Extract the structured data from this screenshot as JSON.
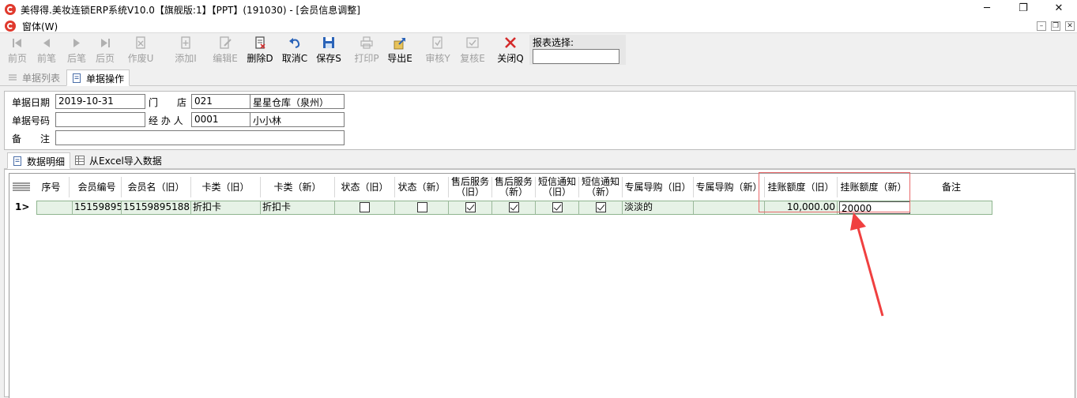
{
  "window": {
    "title": "美得得.美妆连锁ERP系统V10.0【旗舰版:1】【PPT】(191030) - [会员信息调整]",
    "menu": "窗体(W)"
  },
  "toolbar": {
    "buttons": [
      {
        "label": "前页",
        "icon": "first-page-icon",
        "enabled": false
      },
      {
        "label": "前笔",
        "icon": "prev-record-icon",
        "enabled": false
      },
      {
        "label": "后笔",
        "icon": "next-record-icon",
        "enabled": false
      },
      {
        "label": "后页",
        "icon": "last-page-icon",
        "enabled": false
      },
      {
        "label": "作废U",
        "icon": "void-doc-icon",
        "enabled": false
      },
      {
        "label": "添加I",
        "icon": "add-doc-icon",
        "enabled": false
      },
      {
        "label": "编辑E",
        "icon": "edit-doc-icon",
        "enabled": false
      },
      {
        "label": "删除D",
        "icon": "delete-doc-icon",
        "enabled": true
      },
      {
        "label": "取消C",
        "icon": "undo-icon",
        "enabled": true
      },
      {
        "label": "保存S",
        "icon": "save-icon",
        "enabled": true
      },
      {
        "label": "打印P",
        "icon": "printer-icon",
        "enabled": false
      },
      {
        "label": "导出E",
        "icon": "export-icon",
        "enabled": true
      },
      {
        "label": "审核Y",
        "icon": "approve-icon",
        "enabled": false
      },
      {
        "label": "复核E",
        "icon": "recheck-icon",
        "enabled": false
      },
      {
        "label": "关闭Q",
        "icon": "close-icon",
        "enabled": true
      }
    ],
    "report_select_label": "报表选择:",
    "report_select_value": ""
  },
  "tabs": {
    "list": "单据列表",
    "operate": "单据操作"
  },
  "form": {
    "date_label": "单据日期",
    "date_value": "2019-10-31",
    "store_label": "门　　店",
    "store_code": "021",
    "store_name": "星星仓库（泉州）",
    "doc_no_label": "单据号码",
    "doc_no_value": "",
    "handler_label": "经 办 人",
    "handler_code": "0001",
    "handler_name": "小小林",
    "remark_label": "备　　注",
    "remark_value": ""
  },
  "subtabs": {
    "detail": "数据明细",
    "import": "从Excel导入数据"
  },
  "grid": {
    "headers": [
      "序号",
      "会员编号",
      "会员名（旧）",
      "卡类（旧）",
      "卡类（新）",
      "状态（旧）",
      "状态（新）",
      "售后服务（旧）",
      "售后服务（新）",
      "短信通知（旧）",
      "短信通知（新）",
      "专属导购（旧）",
      "专属导购（新）",
      "挂账额度（旧）",
      "挂账额度（新）",
      "备注"
    ],
    "rows": [
      {
        "indicator": "1>",
        "seq": "",
        "member_no": "15159895",
        "member_name_old": "15159895188",
        "card_old": "折扣卡",
        "card_new": "折扣卡",
        "status_old": false,
        "status_new": false,
        "after_sales_old": true,
        "after_sales_new": true,
        "sms_old": true,
        "sms_new": true,
        "guide_old": "淡淡的",
        "guide_new": "",
        "credit_old": "10,000.00",
        "credit_new": "20000",
        "remark": ""
      }
    ]
  },
  "colors": {
    "highlight": "#e8686a",
    "arrow": "#f04040",
    "row_bg": "#e6f2e6"
  }
}
